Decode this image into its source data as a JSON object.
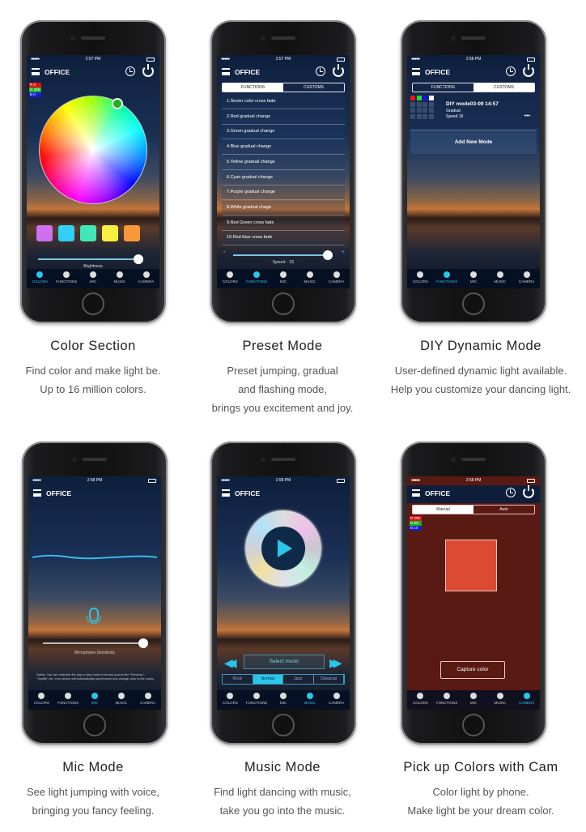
{
  "common": {
    "office": "OFFICE",
    "tabs": [
      "COLORS",
      "FUNCTIONS",
      "MIC",
      "MUSIC",
      "CAMERA"
    ],
    "accent": "#29c6ea",
    "icons": [
      "menu-icon",
      "alarm-clock-icon",
      "power-icon"
    ]
  },
  "phones": [
    {
      "time": "2:57 PM",
      "rgb": [
        "R 0",
        "G 255",
        "B 0"
      ],
      "swatch_colors": [
        "#d070f0",
        "#30d0f8",
        "#40e8b8",
        "#f8f040",
        "#f89838"
      ],
      "brightness_label": "Brightness",
      "brightness": 0.95
    },
    {
      "time": "2:57 PM",
      "seg": [
        "FUNCTIONS",
        "CUSTOMS"
      ],
      "modes": [
        "1.Seven color cross fade",
        "2.Red gradual change",
        "3.Green gradual change",
        "4.Blue gradual change",
        "5.Yellow gradual change",
        "6.Cyan gradual change",
        "7.Purple gradual change",
        "8.White gradual chage",
        "9.Red Green cross fade",
        "10.Red blue cross fade"
      ],
      "speed_label": "Speed - 31",
      "minus": "-",
      "plus": "+",
      "speed": 0.9
    },
    {
      "time": "2:58 PM",
      "seg": [
        "FUNCTIONS",
        "CUSTOMS"
      ],
      "diy_title": "DIY mode03-09 14:57",
      "diy_type": "Gradual",
      "diy_speed": "Speed 16",
      "more": "•••",
      "add_label": "Add New Mode",
      "diy_colors": [
        "#ff1010",
        "#20e020",
        "#1010ff",
        "#ffffff"
      ]
    },
    {
      "time": "2:58 PM",
      "sens_label": "Microphone Sensitivity",
      "sensitivity": 0.95,
      "notice": "Notice: You can minimize the app to play music from any source like \"Pandora\", \"Spotify\" etc. Your device will automatically synchronize and change color to the music."
    },
    {
      "time": "2:58 PM",
      "select_label": "Select music",
      "genres": [
        "Rock",
        "Normal",
        "Jazz",
        "Classical"
      ],
      "active_genre": "Normal"
    },
    {
      "time": "2:58 PM",
      "seg": [
        "Manual",
        "Auto"
      ],
      "rgb": [
        "R 208",
        "G 58",
        "B 10"
      ],
      "captured_color": "#dc4a33",
      "capture_label": "Capture color"
    }
  ],
  "captions": [
    {
      "title": "Color Section",
      "lines": [
        "Find color and make light be.",
        "Up to 16 million colors."
      ]
    },
    {
      "title": "Preset Mode",
      "lines": [
        "Preset jumping, gradual",
        "and flashing mode,",
        "brings you excitement and joy."
      ]
    },
    {
      "title": "DIY Dynamic Mode",
      "lines": [
        "User-defined dynamic light available.",
        "Help you customize your dancing light."
      ]
    },
    {
      "title": "Mic Mode",
      "lines": [
        "See light jumping with voice,",
        "bringing you fancy feeling."
      ]
    },
    {
      "title": "Music Mode",
      "lines": [
        "Find light dancing with music,",
        "take you go into the music."
      ]
    },
    {
      "title": "Pick up Colors with Cam",
      "lines": [
        "Color light by phone.",
        "Make light be your dream color."
      ]
    }
  ]
}
